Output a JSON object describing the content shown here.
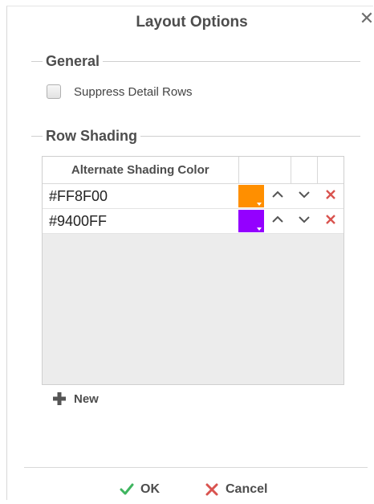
{
  "dialog": {
    "title": "Layout Options",
    "close_icon": "close-icon"
  },
  "general": {
    "legend": "General",
    "suppress_label": "Suppress Detail Rows",
    "suppress_checked": false
  },
  "row_shading": {
    "legend": "Row Shading",
    "column_header": "Alternate Shading Color",
    "rows": [
      {
        "hex": "#FF8F00",
        "color": "#FF8F00"
      },
      {
        "hex": "#9400FF",
        "color": "#9400FF"
      }
    ],
    "icons": {
      "move_up": "chevron-up-icon",
      "move_down": "chevron-down-icon",
      "delete": "delete-x-icon"
    },
    "new_label": "New"
  },
  "footer": {
    "ok_label": "OK",
    "cancel_label": "Cancel"
  },
  "colors": {
    "ok_green": "#3fb560",
    "delete_red": "#d9534f",
    "grid_empty": "#ececec"
  }
}
